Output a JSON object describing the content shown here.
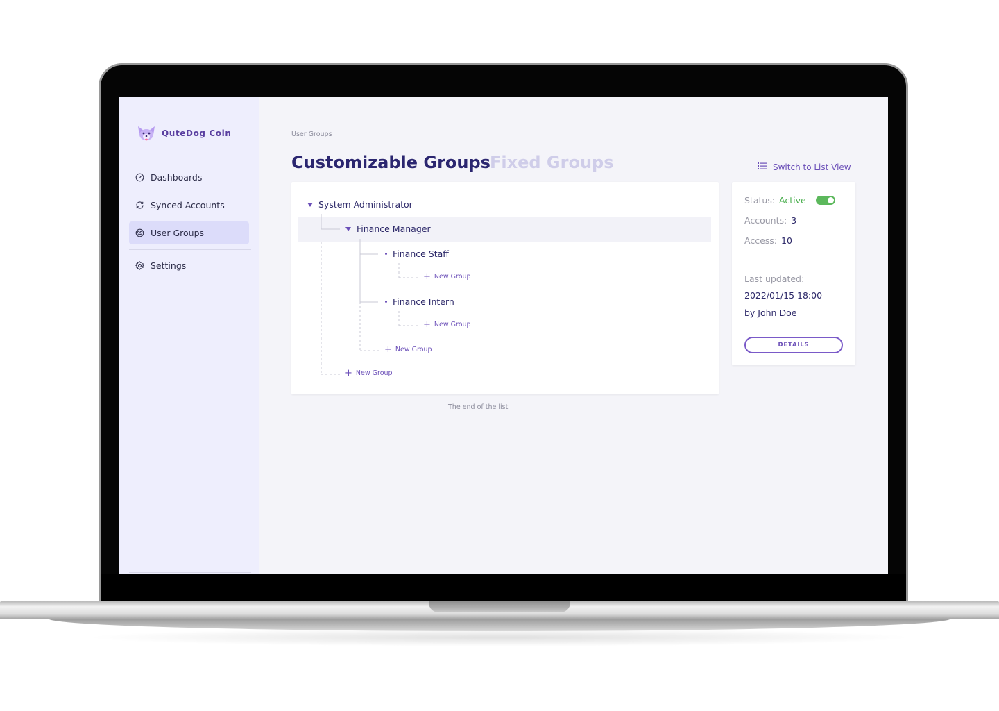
{
  "brand": {
    "name": "QuteDog Coin"
  },
  "sidebar": {
    "items": [
      {
        "label": "Dashboards",
        "icon": "gauge-icon",
        "active": false
      },
      {
        "label": "Synced Accounts",
        "icon": "sync-icon",
        "active": false
      },
      {
        "label": "User Groups",
        "icon": "groups-icon",
        "active": true
      },
      {
        "label": "Settings",
        "icon": "gear-icon",
        "active": false
      }
    ]
  },
  "header": {
    "breadcrumb": "User Groups",
    "tabs": [
      {
        "label": "Customizable Groups",
        "active": true
      },
      {
        "label": "Fixed Groups",
        "active": false
      }
    ],
    "switch_view_label": "Switch to List View"
  },
  "tree": {
    "root": "System Administrator",
    "level1": "Finance Manager",
    "level2": [
      "Finance Staff",
      "Finance Intern"
    ],
    "new_group_label": "New Group"
  },
  "footer_note": "The end of the list",
  "details_panel": {
    "status_label": "Status:",
    "status_value": "Active",
    "status_on": true,
    "accounts_label": "Accounts:",
    "accounts_value": "3",
    "access_label": "Access:",
    "access_value": "10",
    "last_updated_label": "Last updated:",
    "last_updated_value": "2022/01/15 18:00",
    "updated_by": "by John Doe",
    "details_button": "DETAILS"
  },
  "colors": {
    "accent": "#6b4fb8",
    "title": "#2b2670",
    "active_status": "#4caf50",
    "sidebar_bg": "#eeeefd"
  }
}
